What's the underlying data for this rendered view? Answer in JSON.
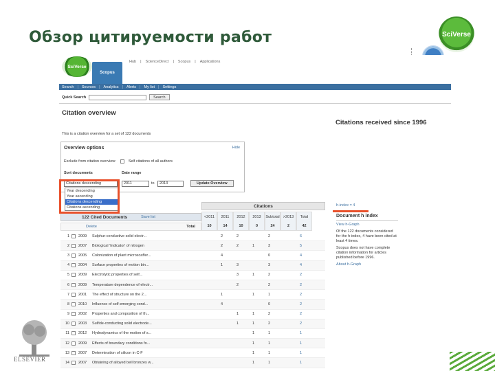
{
  "slide": {
    "title": "Обзор цитируемости работ",
    "badge": "SciVerse"
  },
  "screenshot": {
    "brand": {
      "logo": "SciVerse",
      "tab": "Scopus"
    },
    "top_links": [
      "Hub",
      "|",
      "ScienceDirect",
      "|",
      "Scopus",
      "|",
      "Applications"
    ],
    "nav": [
      "Search",
      "Sources",
      "Analytics",
      "Alerts",
      "My list",
      "Settings"
    ],
    "quick_search": {
      "label": "Quick Search",
      "button": "Search"
    },
    "page_title": "Citation overview",
    "right_title": "Citations received since 1996",
    "intro": "This is a citation overview for a set of 122 documents",
    "options": {
      "title": "Overview options",
      "hide": "Hide",
      "exclude_label": "Exclude from citation overview:",
      "exclude_option": "Self citations of all authors",
      "sort_label": "Sort documents",
      "date_label": "Date range",
      "sort_value": "Citations descending",
      "from": "2011",
      "to_label": "to",
      "to": "2013",
      "update_button": "Update Overview"
    },
    "dropdown": [
      "Year descending",
      "Year ascending",
      "Citations descending",
      "Citations ascending"
    ],
    "dropdown_selected_index": 2,
    "grid": {
      "citations_header": "Citations",
      "cited_label": "122 Cited Documents",
      "save_list": "Save list",
      "delete": "Delete",
      "total_label": "Total",
      "year_headers": [
        {
          "label": "<2011",
          "total": "10"
        },
        {
          "label": "2011",
          "total": "14"
        },
        {
          "label": "2012",
          "total": "10"
        },
        {
          "label": "2013",
          "total": "0"
        },
        {
          "label": "Subtotal",
          "total": "24"
        },
        {
          "label": ">2013",
          "total": "2"
        },
        {
          "label": "Total",
          "total": "42"
        }
      ],
      "rows": [
        {
          "n": "1",
          "year": "2009",
          "title": "Sulphur-conductive solid electr...",
          "c": [
            "",
            "2",
            "2",
            "",
            "2",
            "",
            "6"
          ]
        },
        {
          "n": "2",
          "year": "2007",
          "title": "Biological 'Indicator' of nitrogen",
          "c": [
            "",
            "2",
            "2",
            "1",
            "3",
            "",
            "5"
          ]
        },
        {
          "n": "3",
          "year": "2005",
          "title": "Colonization of plant microscaffer...",
          "c": [
            "",
            "4",
            "",
            "",
            "0",
            "",
            "4"
          ]
        },
        {
          "n": "4",
          "year": "2004",
          "title": "Surface properties of motion bin...",
          "c": [
            "",
            "1",
            "3",
            "",
            "3",
            "",
            "4"
          ]
        },
        {
          "n": "5",
          "year": "2009",
          "title": "Electrolytic properties of self...",
          "c": [
            "",
            "",
            "3",
            "1",
            "2",
            "",
            "2"
          ]
        },
        {
          "n": "6",
          "year": "2009",
          "title": "Temperature dependence of electr...",
          "c": [
            "",
            "",
            "2",
            "",
            "2",
            "",
            "2"
          ]
        },
        {
          "n": "7",
          "year": "2001",
          "title": "The effect of structure on the 2...",
          "c": [
            "",
            "1",
            "",
            "1",
            "1",
            "",
            "2"
          ]
        },
        {
          "n": "8",
          "year": "2010",
          "title": "Influence of self-emerging cond...",
          "c": [
            "",
            "4",
            "",
            "",
            "0",
            "",
            "2"
          ]
        },
        {
          "n": "9",
          "year": "2002",
          "title": "Properties and composition of th...",
          "c": [
            "",
            "",
            "1",
            "1",
            "2",
            "",
            "2"
          ]
        },
        {
          "n": "10",
          "year": "2003",
          "title": "Sulfide-conducting solid electrode...",
          "c": [
            "",
            "",
            "1",
            "1",
            "2",
            "",
            "2"
          ]
        },
        {
          "n": "11",
          "year": "2012",
          "title": "Hydrodynamics of the motion of s...",
          "c": [
            "",
            "",
            "",
            "1",
            "1",
            "",
            "1"
          ]
        },
        {
          "n": "12",
          "year": "2009",
          "title": "Effects of boundary conditions fo...",
          "c": [
            "",
            "",
            "",
            "1",
            "1",
            "",
            "1"
          ]
        },
        {
          "n": "13",
          "year": "2007",
          "title": "Determination of silicon in C-F",
          "c": [
            "",
            "",
            "",
            "1",
            "1",
            "",
            "1"
          ]
        },
        {
          "n": "14",
          "year": "2007",
          "title": "Obtaining of alloyed bell bronzes w...",
          "c": [
            "",
            "",
            "",
            "1",
            "1",
            "",
            "1"
          ]
        }
      ]
    },
    "hindex": {
      "small": "h-index = 4",
      "title": "Document h index",
      "link": "View h-Graph",
      "p1": "Of the 122 documents considered for the h-index, 4 have been cited at least 4 times.",
      "p2": "Scopus does not have complete citation information for articles published before 1996.",
      "p3": "About h-Graph"
    }
  },
  "publisher": "ELSEVIER"
}
